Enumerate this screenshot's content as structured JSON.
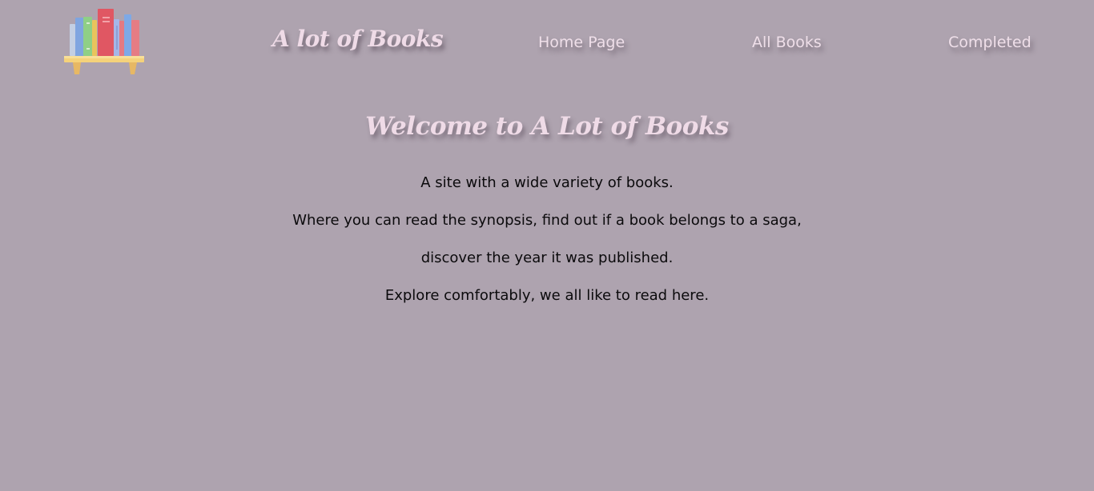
{
  "header": {
    "brand_title": "A lot of Books",
    "logo_icon": "bookshelf-icon",
    "nav": {
      "home": "Home Page",
      "all_books": "All Books",
      "completed": "Completed"
    }
  },
  "main": {
    "heading": "Welcome to A Lot of Books",
    "paragraphs": [
      "A site with a wide variety of books.",
      "Where you can read the synopsis, find out if a book belongs to a saga,",
      "discover the year it was published.",
      "Explore comfortably, we all like to read here."
    ]
  },
  "colors": {
    "background": "#aea3af",
    "heading_pink": "#efdbe7",
    "body_text": "#0b0a0c"
  }
}
